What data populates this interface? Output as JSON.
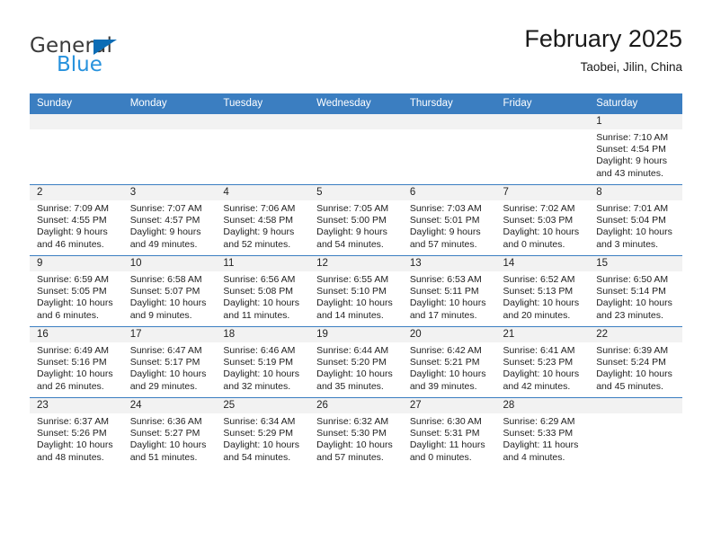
{
  "brand": {
    "name_part1": "General",
    "name_part2": "Blue",
    "accent_color": "#2792dd",
    "triangle_color": "#0b6cb5"
  },
  "header": {
    "title": "February 2025",
    "location": "Taobei, Jilin, China"
  },
  "calendar": {
    "header_bg": "#3b7ec1",
    "weekdays": [
      "Sunday",
      "Monday",
      "Tuesday",
      "Wednesday",
      "Thursday",
      "Friday",
      "Saturday"
    ],
    "weeks": [
      [
        {
          "day": "",
          "sunrise": "",
          "sunset": "",
          "daylight": "",
          "daylight2": ""
        },
        {
          "day": "",
          "sunrise": "",
          "sunset": "",
          "daylight": "",
          "daylight2": ""
        },
        {
          "day": "",
          "sunrise": "",
          "sunset": "",
          "daylight": "",
          "daylight2": ""
        },
        {
          "day": "",
          "sunrise": "",
          "sunset": "",
          "daylight": "",
          "daylight2": ""
        },
        {
          "day": "",
          "sunrise": "",
          "sunset": "",
          "daylight": "",
          "daylight2": ""
        },
        {
          "day": "",
          "sunrise": "",
          "sunset": "",
          "daylight": "",
          "daylight2": ""
        },
        {
          "day": "1",
          "sunrise": "Sunrise: 7:10 AM",
          "sunset": "Sunset: 4:54 PM",
          "daylight": "Daylight: 9 hours",
          "daylight2": "and 43 minutes."
        }
      ],
      [
        {
          "day": "2",
          "sunrise": "Sunrise: 7:09 AM",
          "sunset": "Sunset: 4:55 PM",
          "daylight": "Daylight: 9 hours",
          "daylight2": "and 46 minutes."
        },
        {
          "day": "3",
          "sunrise": "Sunrise: 7:07 AM",
          "sunset": "Sunset: 4:57 PM",
          "daylight": "Daylight: 9 hours",
          "daylight2": "and 49 minutes."
        },
        {
          "day": "4",
          "sunrise": "Sunrise: 7:06 AM",
          "sunset": "Sunset: 4:58 PM",
          "daylight": "Daylight: 9 hours",
          "daylight2": "and 52 minutes."
        },
        {
          "day": "5",
          "sunrise": "Sunrise: 7:05 AM",
          "sunset": "Sunset: 5:00 PM",
          "daylight": "Daylight: 9 hours",
          "daylight2": "and 54 minutes."
        },
        {
          "day": "6",
          "sunrise": "Sunrise: 7:03 AM",
          "sunset": "Sunset: 5:01 PM",
          "daylight": "Daylight: 9 hours",
          "daylight2": "and 57 minutes."
        },
        {
          "day": "7",
          "sunrise": "Sunrise: 7:02 AM",
          "sunset": "Sunset: 5:03 PM",
          "daylight": "Daylight: 10 hours",
          "daylight2": "and 0 minutes."
        },
        {
          "day": "8",
          "sunrise": "Sunrise: 7:01 AM",
          "sunset": "Sunset: 5:04 PM",
          "daylight": "Daylight: 10 hours",
          "daylight2": "and 3 minutes."
        }
      ],
      [
        {
          "day": "9",
          "sunrise": "Sunrise: 6:59 AM",
          "sunset": "Sunset: 5:05 PM",
          "daylight": "Daylight: 10 hours",
          "daylight2": "and 6 minutes."
        },
        {
          "day": "10",
          "sunrise": "Sunrise: 6:58 AM",
          "sunset": "Sunset: 5:07 PM",
          "daylight": "Daylight: 10 hours",
          "daylight2": "and 9 minutes."
        },
        {
          "day": "11",
          "sunrise": "Sunrise: 6:56 AM",
          "sunset": "Sunset: 5:08 PM",
          "daylight": "Daylight: 10 hours",
          "daylight2": "and 11 minutes."
        },
        {
          "day": "12",
          "sunrise": "Sunrise: 6:55 AM",
          "sunset": "Sunset: 5:10 PM",
          "daylight": "Daylight: 10 hours",
          "daylight2": "and 14 minutes."
        },
        {
          "day": "13",
          "sunrise": "Sunrise: 6:53 AM",
          "sunset": "Sunset: 5:11 PM",
          "daylight": "Daylight: 10 hours",
          "daylight2": "and 17 minutes."
        },
        {
          "day": "14",
          "sunrise": "Sunrise: 6:52 AM",
          "sunset": "Sunset: 5:13 PM",
          "daylight": "Daylight: 10 hours",
          "daylight2": "and 20 minutes."
        },
        {
          "day": "15",
          "sunrise": "Sunrise: 6:50 AM",
          "sunset": "Sunset: 5:14 PM",
          "daylight": "Daylight: 10 hours",
          "daylight2": "and 23 minutes."
        }
      ],
      [
        {
          "day": "16",
          "sunrise": "Sunrise: 6:49 AM",
          "sunset": "Sunset: 5:16 PM",
          "daylight": "Daylight: 10 hours",
          "daylight2": "and 26 minutes."
        },
        {
          "day": "17",
          "sunrise": "Sunrise: 6:47 AM",
          "sunset": "Sunset: 5:17 PM",
          "daylight": "Daylight: 10 hours",
          "daylight2": "and 29 minutes."
        },
        {
          "day": "18",
          "sunrise": "Sunrise: 6:46 AM",
          "sunset": "Sunset: 5:19 PM",
          "daylight": "Daylight: 10 hours",
          "daylight2": "and 32 minutes."
        },
        {
          "day": "19",
          "sunrise": "Sunrise: 6:44 AM",
          "sunset": "Sunset: 5:20 PM",
          "daylight": "Daylight: 10 hours",
          "daylight2": "and 35 minutes."
        },
        {
          "day": "20",
          "sunrise": "Sunrise: 6:42 AM",
          "sunset": "Sunset: 5:21 PM",
          "daylight": "Daylight: 10 hours",
          "daylight2": "and 39 minutes."
        },
        {
          "day": "21",
          "sunrise": "Sunrise: 6:41 AM",
          "sunset": "Sunset: 5:23 PM",
          "daylight": "Daylight: 10 hours",
          "daylight2": "and 42 minutes."
        },
        {
          "day": "22",
          "sunrise": "Sunrise: 6:39 AM",
          "sunset": "Sunset: 5:24 PM",
          "daylight": "Daylight: 10 hours",
          "daylight2": "and 45 minutes."
        }
      ],
      [
        {
          "day": "23",
          "sunrise": "Sunrise: 6:37 AM",
          "sunset": "Sunset: 5:26 PM",
          "daylight": "Daylight: 10 hours",
          "daylight2": "and 48 minutes."
        },
        {
          "day": "24",
          "sunrise": "Sunrise: 6:36 AM",
          "sunset": "Sunset: 5:27 PM",
          "daylight": "Daylight: 10 hours",
          "daylight2": "and 51 minutes."
        },
        {
          "day": "25",
          "sunrise": "Sunrise: 6:34 AM",
          "sunset": "Sunset: 5:29 PM",
          "daylight": "Daylight: 10 hours",
          "daylight2": "and 54 minutes."
        },
        {
          "day": "26",
          "sunrise": "Sunrise: 6:32 AM",
          "sunset": "Sunset: 5:30 PM",
          "daylight": "Daylight: 10 hours",
          "daylight2": "and 57 minutes."
        },
        {
          "day": "27",
          "sunrise": "Sunrise: 6:30 AM",
          "sunset": "Sunset: 5:31 PM",
          "daylight": "Daylight: 11 hours",
          "daylight2": "and 0 minutes."
        },
        {
          "day": "28",
          "sunrise": "Sunrise: 6:29 AM",
          "sunset": "Sunset: 5:33 PM",
          "daylight": "Daylight: 11 hours",
          "daylight2": "and 4 minutes."
        },
        {
          "day": "",
          "sunrise": "",
          "sunset": "",
          "daylight": "",
          "daylight2": ""
        }
      ]
    ]
  }
}
